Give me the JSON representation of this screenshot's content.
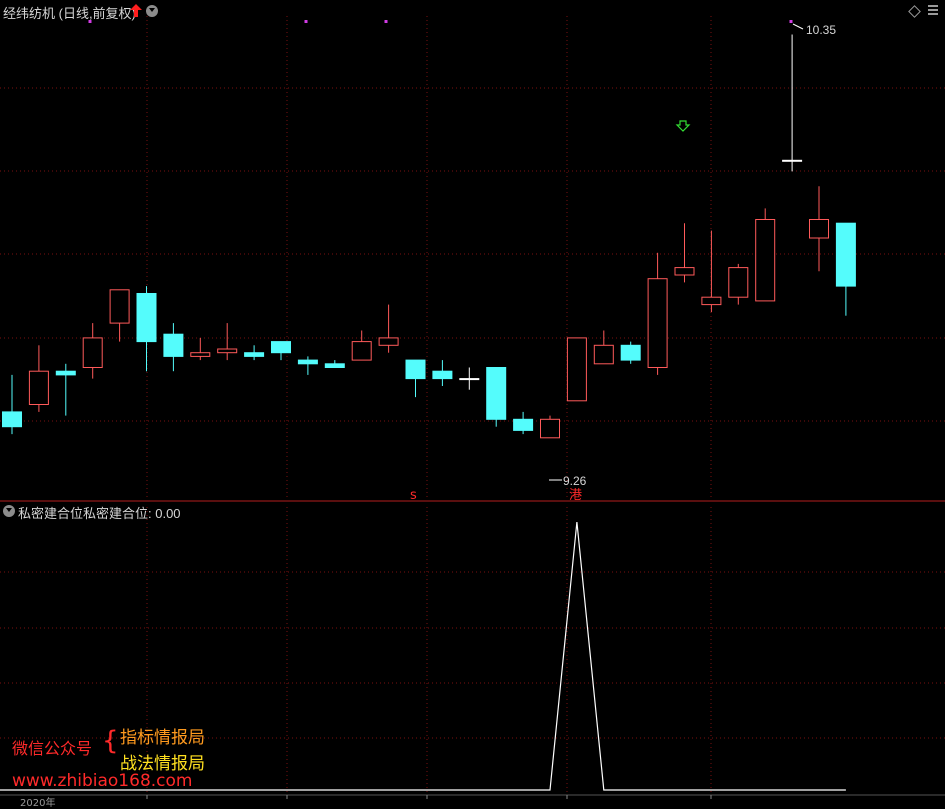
{
  "header": {
    "title": "经纬纺机 (日线,前复权)",
    "high_label": "10.35",
    "low_label": "9.26"
  },
  "indicator": {
    "name": "私密建合位",
    "value_text": "私密建合位: 0.00"
  },
  "markers": {
    "s_mark": "s",
    "gang_mark": "港"
  },
  "watermark": {
    "left_label": "微信公众号",
    "brace": "{",
    "line1": "指标情报局",
    "line2": "战法情报局",
    "url": "www.zhibiao168.com"
  },
  "axis": {
    "partial_label": "2020年"
  },
  "colors": {
    "up": "#ff5a5a",
    "down": "#54fcfc",
    "grid": "#7a1010",
    "divider": "#b41e1e",
    "text": "#d6d6d6"
  },
  "chart_data": {
    "type": "candlestick",
    "price_range": [
      9.1,
      10.4
    ],
    "candles": [
      {
        "o": 9.33,
        "h": 9.43,
        "l": 9.27,
        "c": 9.29
      },
      {
        "o": 9.35,
        "h": 9.51,
        "l": 9.33,
        "c": 9.44
      },
      {
        "o": 9.44,
        "h": 9.46,
        "l": 9.32,
        "c": 9.43
      },
      {
        "o": 9.45,
        "h": 9.57,
        "l": 9.42,
        "c": 9.53
      },
      {
        "o": 9.57,
        "h": 9.64,
        "l": 9.52,
        "c": 9.66
      },
      {
        "o": 9.65,
        "h": 9.67,
        "l": 9.44,
        "c": 9.52
      },
      {
        "o": 9.54,
        "h": 9.57,
        "l": 9.44,
        "c": 9.48
      },
      {
        "o": 9.48,
        "h": 9.53,
        "l": 9.47,
        "c": 9.49
      },
      {
        "o": 9.49,
        "h": 9.57,
        "l": 9.47,
        "c": 9.5
      },
      {
        "o": 9.49,
        "h": 9.51,
        "l": 9.47,
        "c": 9.48
      },
      {
        "o": 9.52,
        "h": 9.52,
        "l": 9.47,
        "c": 9.49
      },
      {
        "o": 9.47,
        "h": 9.48,
        "l": 9.43,
        "c": 9.46
      },
      {
        "o": 9.46,
        "h": 9.47,
        "l": 9.45,
        "c": 9.45
      },
      {
        "o": 9.47,
        "h": 9.55,
        "l": 9.47,
        "c": 9.52
      },
      {
        "o": 9.51,
        "h": 9.62,
        "l": 9.49,
        "c": 9.53
      },
      {
        "o": 9.47,
        "h": 9.47,
        "l": 9.37,
        "c": 9.42
      },
      {
        "o": 9.44,
        "h": 9.47,
        "l": 9.4,
        "c": 9.42
      },
      {
        "o": 9.42,
        "h": 9.45,
        "l": 9.39,
        "c": 9.42
      },
      {
        "o": 9.45,
        "h": 9.45,
        "l": 9.29,
        "c": 9.31
      },
      {
        "o": 9.31,
        "h": 9.33,
        "l": 9.27,
        "c": 9.28
      },
      {
        "o": 9.26,
        "h": 9.32,
        "l": 9.26,
        "c": 9.31
      },
      {
        "o": 9.36,
        "h": 9.53,
        "l": 9.36,
        "c": 9.53
      },
      {
        "o": 9.46,
        "h": 9.55,
        "l": 9.46,
        "c": 9.51
      },
      {
        "o": 9.51,
        "h": 9.52,
        "l": 9.46,
        "c": 9.47
      },
      {
        "o": 9.45,
        "h": 9.76,
        "l": 9.43,
        "c": 9.69
      },
      {
        "o": 9.7,
        "h": 9.84,
        "l": 9.68,
        "c": 9.72
      },
      {
        "o": 9.62,
        "h": 9.82,
        "l": 9.6,
        "c": 9.64
      },
      {
        "o": 9.64,
        "h": 9.73,
        "l": 9.62,
        "c": 9.72
      },
      {
        "o": 9.63,
        "h": 9.88,
        "l": 9.63,
        "c": 9.85
      },
      {
        "o": 10.01,
        "h": 10.35,
        "l": 9.98,
        "c": 10.01
      },
      {
        "o": 9.8,
        "h": 9.94,
        "l": 9.71,
        "c": 9.85
      },
      {
        "o": 9.84,
        "h": 9.84,
        "l": 9.59,
        "c": 9.67
      }
    ],
    "indicator_series": {
      "name": "私密建合位",
      "range": [
        0,
        1
      ],
      "values": [
        0,
        0,
        0,
        0,
        0,
        0,
        0,
        0,
        0,
        0,
        0,
        0,
        0,
        0,
        0,
        0,
        0,
        0,
        0,
        0,
        0,
        1,
        0,
        0,
        0,
        0,
        0,
        0,
        0,
        0,
        0,
        0
      ]
    }
  }
}
